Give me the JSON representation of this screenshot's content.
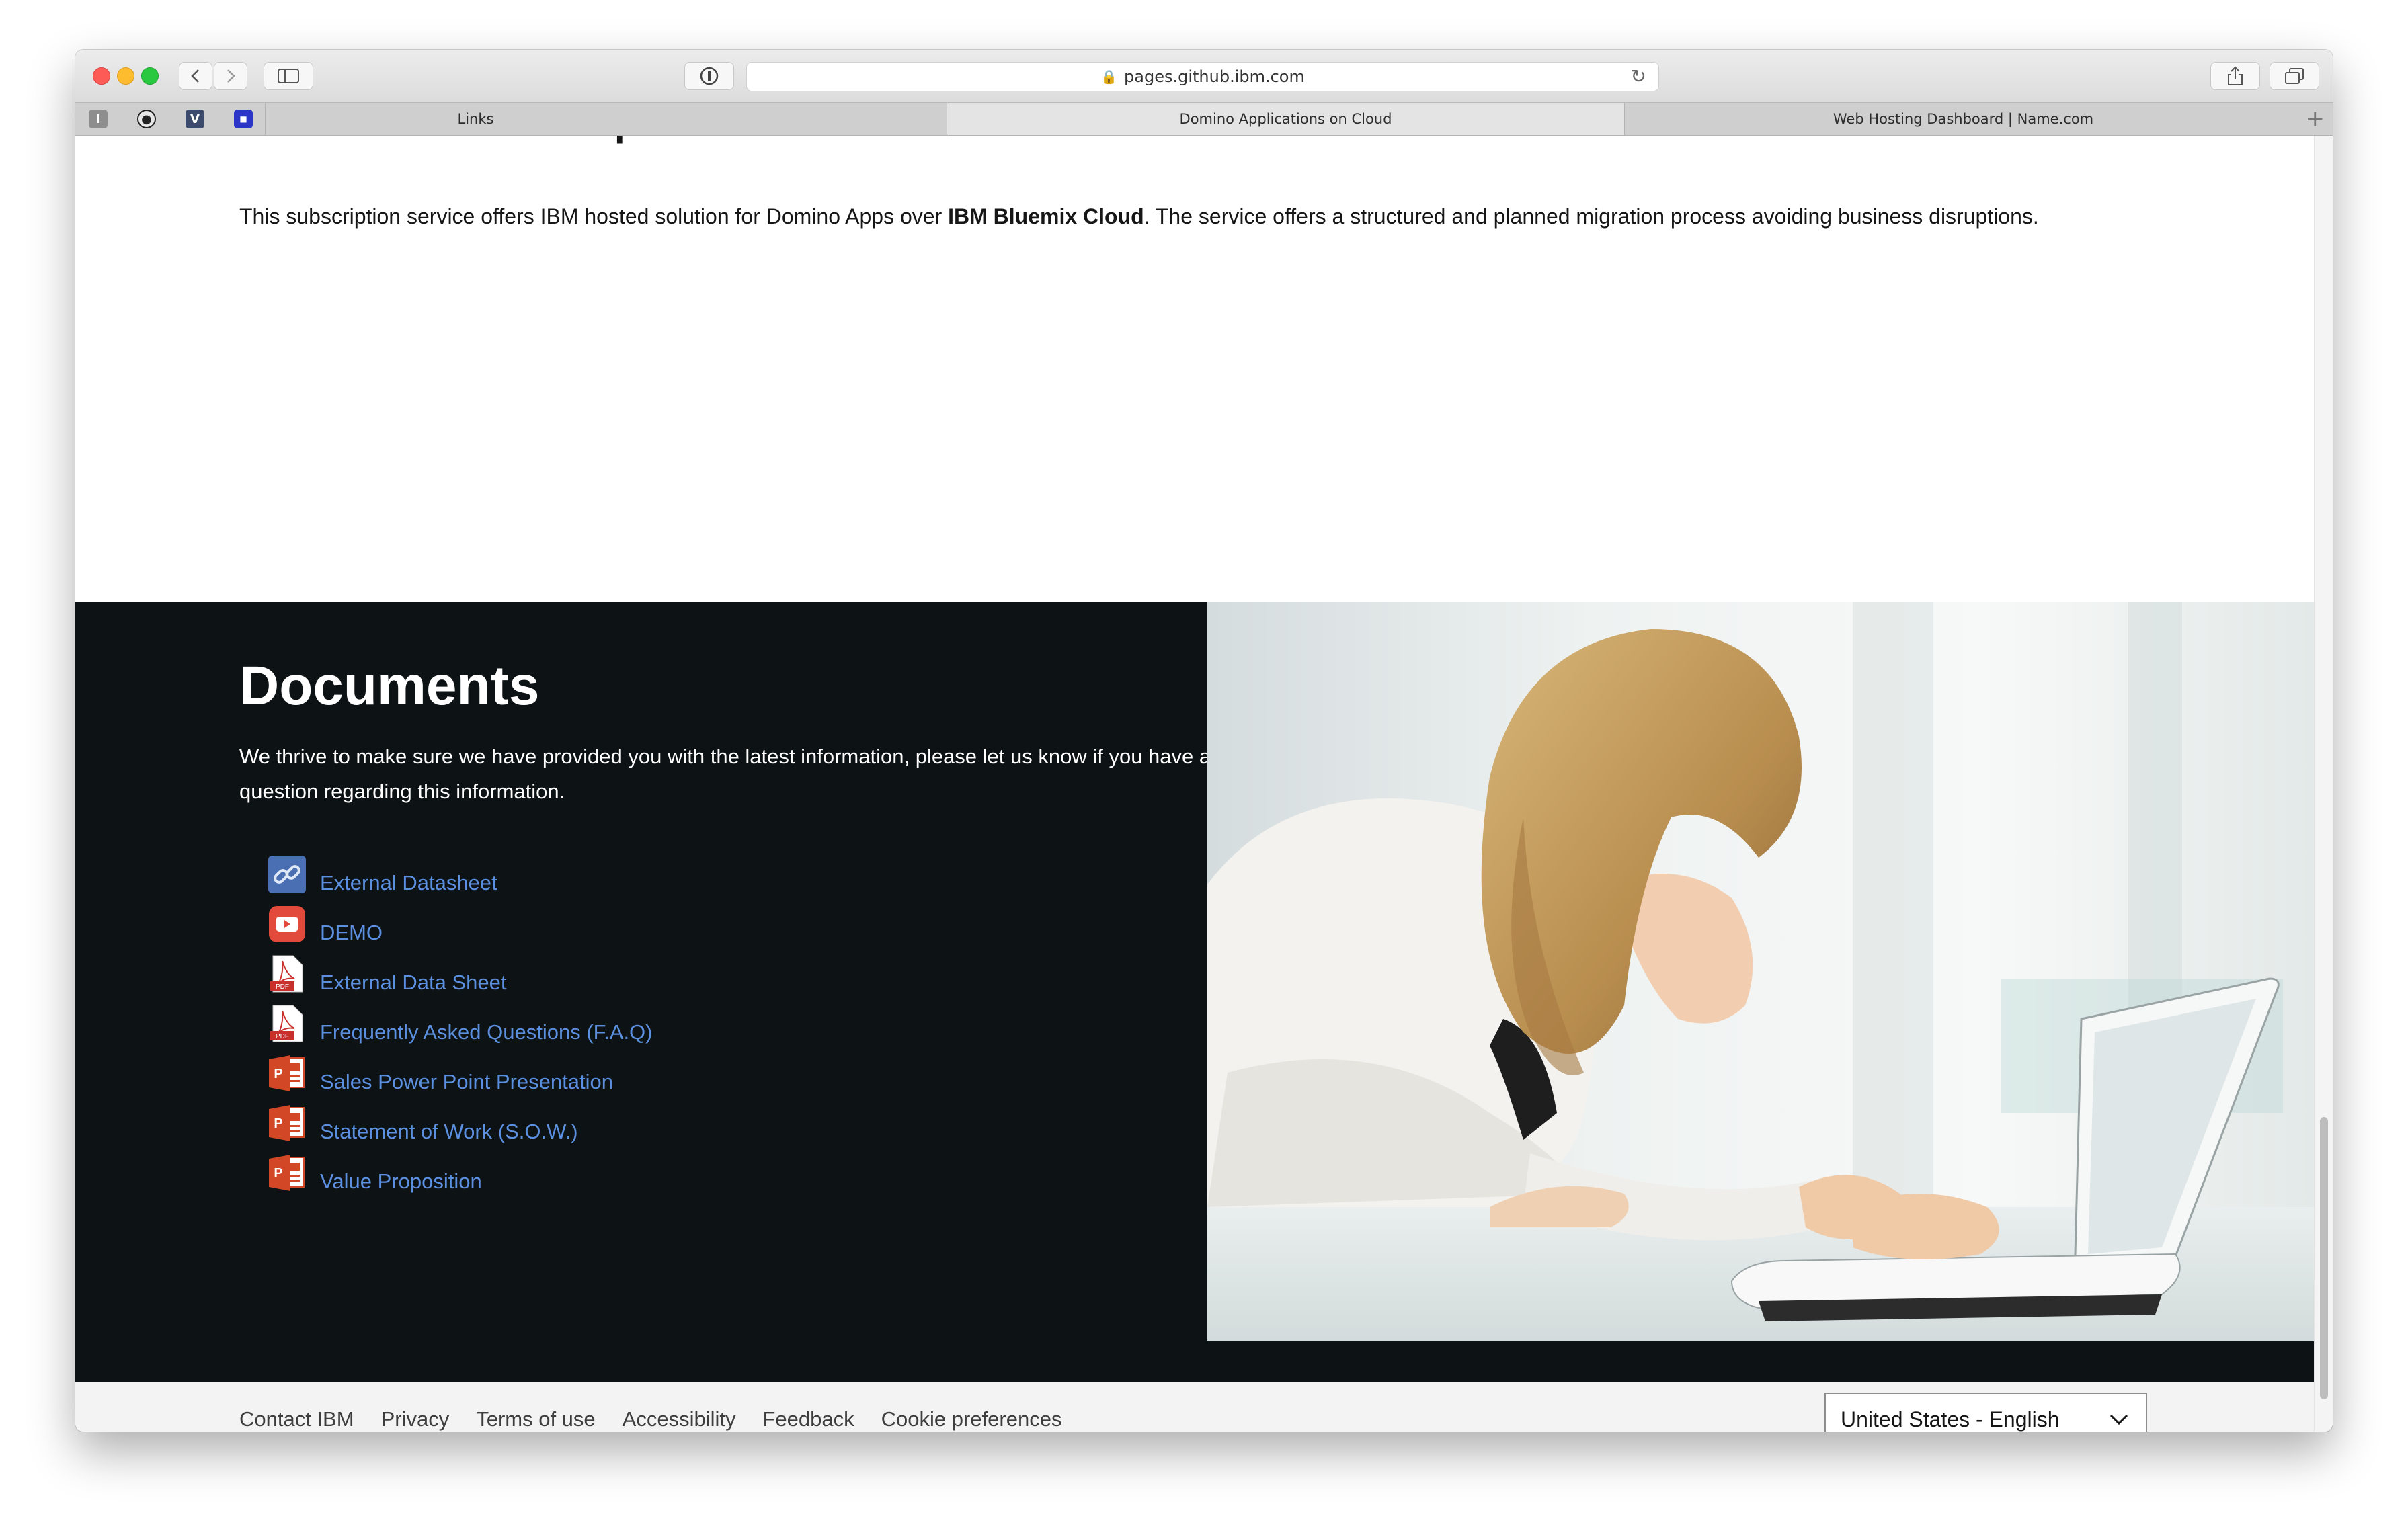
{
  "browser": {
    "url": "pages.github.ibm.com",
    "tabs": [
      {
        "label": "Links"
      },
      {
        "label": "Domino Applications on Cloud"
      },
      {
        "label": "Web Hosting Dashboard | Name.com"
      }
    ],
    "favorites": [
      {
        "icon": "ibm-favicon"
      },
      {
        "icon": "1password-favicon"
      },
      {
        "icon": "v-favicon"
      },
      {
        "icon": "bookmark-favicon"
      }
    ]
  },
  "page": {
    "cut_heading": "The Value Proposition",
    "intro": {
      "before": "This subscription service offers IBM hosted solution for Domino Apps over ",
      "bold": "IBM Bluemix Cloud",
      "after": ". The service offers a structured and planned migration process avoiding business disruptions."
    },
    "documents": {
      "title": "Documents",
      "text": "We thrive to make sure we have provided you with the latest information, please let us know if you have a question regarding this information.",
      "items": [
        {
          "label": "External Datasheet",
          "icon": "link-icon"
        },
        {
          "label": "DEMO",
          "icon": "youtube-icon"
        },
        {
          "label": "External Data Sheet",
          "icon": "pdf-icon"
        },
        {
          "label": "Frequently Asked Questions (F.A.Q)",
          "icon": "pdf-icon"
        },
        {
          "label": "Sales Power Point Presentation",
          "icon": "powerpoint-icon"
        },
        {
          "label": "Statement of Work (S.O.W.)",
          "icon": "powerpoint-icon"
        },
        {
          "label": "Value Proposition",
          "icon": "powerpoint-icon"
        }
      ],
      "pdf_badge": "PDF",
      "ppt_letter": "P"
    },
    "footer": {
      "links": [
        "Contact IBM",
        "Privacy",
        "Terms of use",
        "Accessibility",
        "Feedback",
        "Cookie preferences"
      ],
      "locale": "United States - English"
    }
  },
  "colors": {
    "docs_bg": "#0d1214",
    "link": "#5b8fe0",
    "footer_bg": "#f3f3f3"
  }
}
